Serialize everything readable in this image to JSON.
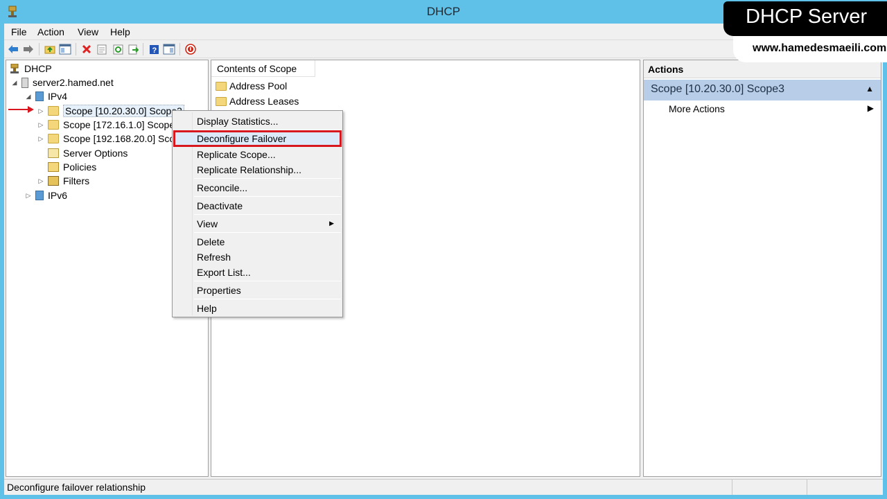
{
  "window": {
    "title": "DHCP"
  },
  "menubar": {
    "items": [
      "File",
      "Action",
      "View",
      "Help"
    ]
  },
  "toolbar": {
    "buttons": [
      "back-icon",
      "forward-icon",
      "up-folder-icon",
      "show-hide-tree-icon",
      "delete-icon",
      "properties-icon",
      "refresh-icon",
      "export-icon",
      "help-icon",
      "show-hide-action-icon",
      "stop-icon"
    ]
  },
  "tree": {
    "root": "DHCP",
    "server": "server2.hamed.net",
    "ipv4": "IPv4",
    "scopes": [
      "Scope [10.20.30.0] Scope3",
      "Scope [172.16.1.0] Scope",
      "Scope [192.168.20.0] Sco"
    ],
    "server_options": "Server Options",
    "policies": "Policies",
    "filters": "Filters",
    "ipv6": "IPv6"
  },
  "content": {
    "column_header": "Contents of Scope",
    "items": [
      "Address Pool",
      "Address Leases"
    ]
  },
  "context_menu": {
    "items": [
      "Display Statistics...",
      "Deconfigure Failover",
      "Replicate Scope...",
      "Replicate Relationship...",
      "Reconcile...",
      "Deactivate",
      "View",
      "Delete",
      "Refresh",
      "Export List...",
      "Properties",
      "Help"
    ],
    "highlighted": "Deconfigure Failover"
  },
  "actions_pane": {
    "header": "Actions",
    "scope_title": "Scope [10.20.30.0] Scope3",
    "more_actions": "More Actions"
  },
  "statusbar": {
    "text": "Deconfigure failover relationship"
  },
  "overlay": {
    "banner": "DHCP Server",
    "url": "www.hamedesmaeili.com"
  },
  "colors": {
    "titlebar": "#5fc0e8",
    "highlight_outline": "#d8171f",
    "actions_scope_bg": "#b7cde8"
  }
}
